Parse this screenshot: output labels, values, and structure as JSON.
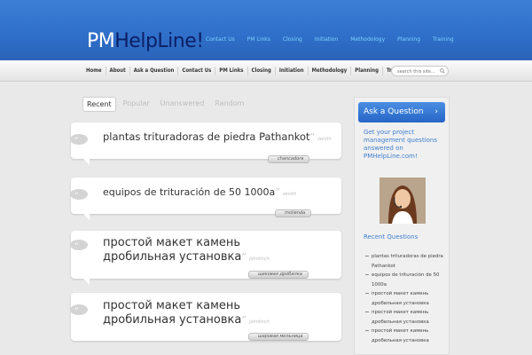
{
  "logo": {
    "pm": "PM",
    "helpline": "HelpLine!"
  },
  "top_links": [
    "Contact Us",
    "PM Links",
    "Closing",
    "Initiation",
    "Methodology",
    "Planning",
    "Training"
  ],
  "nav": [
    "Home",
    "About",
    "Ask a Question",
    "Contact Us",
    "PM Links",
    "Closing",
    "Initiation",
    "Methodology",
    "Planning",
    "Training"
  ],
  "search": {
    "placeholder": "search this site..."
  },
  "tabs": [
    "Recent",
    "Popular",
    "Unanswered",
    "Random"
  ],
  "questions": [
    {
      "title": "plantas trituradoras de piedra Pathankot",
      "author": "zenith",
      "tag": "chancadora"
    },
    {
      "title": "equipos de trituración de 50 1000a",
      "author": "zenith",
      "tag": "molienda"
    },
    {
      "title_line1": "простой макет камень",
      "title_line2": "дробильная установка",
      "author": "johnlinch",
      "tag": "щековая дробилка"
    },
    {
      "title_line1": "простой макет камень",
      "title_line2": "дробильная установка",
      "author": "johnlinch",
      "tag": "шаровая мельница"
    }
  ],
  "sidebar": {
    "ask_button": "Ask a Question",
    "blurb": "Get your project management questions answered on PMHelpLine.com!",
    "recent_title": "Recent Questions",
    "recent": [
      "plantas trituradoras de piedra Pathankot",
      "equipos de trituración de 50 1000a",
      "простой макет камень дробильная установка",
      "простой макет камень дробильная установка",
      "простой макет камень дробильная установка"
    ]
  },
  "colors": {
    "header_blue": "#2f6fc9",
    "link_blue": "#3f7fd1",
    "logo_dark": "#0b1f66"
  }
}
